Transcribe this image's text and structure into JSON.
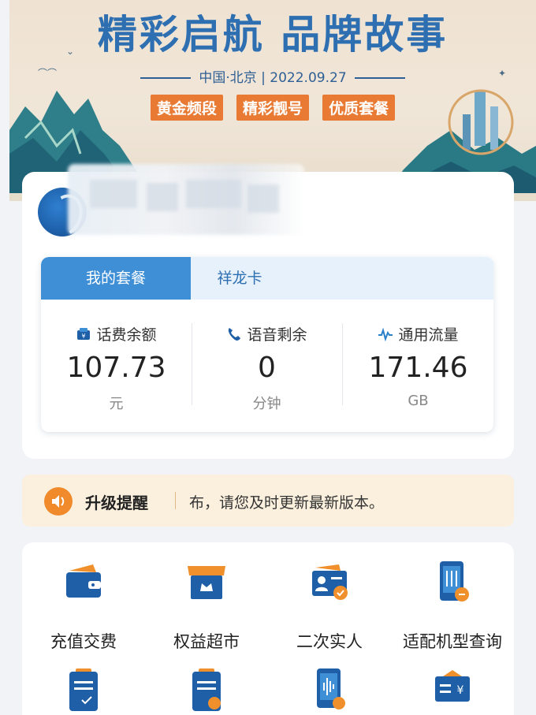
{
  "banner": {
    "title": "精彩启航 品牌故事",
    "subtitle": "中国·北京 | 2022.09.27",
    "tags": [
      "黄金频段",
      "精彩靓号",
      "优质套餐"
    ]
  },
  "package": {
    "tabs": [
      "我的套餐",
      "祥龙卡"
    ],
    "stats": [
      {
        "label": "话费余额",
        "value": "107.73",
        "unit": "元",
        "icon": "wallet-icon"
      },
      {
        "label": "语音剩余",
        "value": "0",
        "unit": "分钟",
        "icon": "phone-icon"
      },
      {
        "label": "通用流量",
        "value": "171.46",
        "unit": "GB",
        "icon": "signal-icon"
      }
    ]
  },
  "notice": {
    "title": "升级提醒",
    "message": "布，请您及时更新最新版本。"
  },
  "services": [
    {
      "label": "充值交费",
      "icon": "wallet-icon"
    },
    {
      "label": "权益超市",
      "icon": "store-icon"
    },
    {
      "label": "二次实人",
      "icon": "id-card-icon"
    },
    {
      "label": "适配机型查询",
      "icon": "phone-settings-icon"
    },
    {
      "label": "",
      "icon": "clipboard-check-icon"
    },
    {
      "label": "",
      "icon": "clipboard-month-icon"
    },
    {
      "label": "",
      "icon": "phone-voice-icon"
    },
    {
      "label": "",
      "icon": "bill-icon"
    }
  ],
  "colors": {
    "primary": "#3f8fd6",
    "tab_bg": "#e6f1fb",
    "banner_blue": "#2e6fb1",
    "tag_orange": "#e87a33",
    "notice_bg": "#fbf0de",
    "notice_icon": "#f08a2a",
    "icon_blue": "#1f5fa8",
    "icon_orange": "#f0902c"
  }
}
